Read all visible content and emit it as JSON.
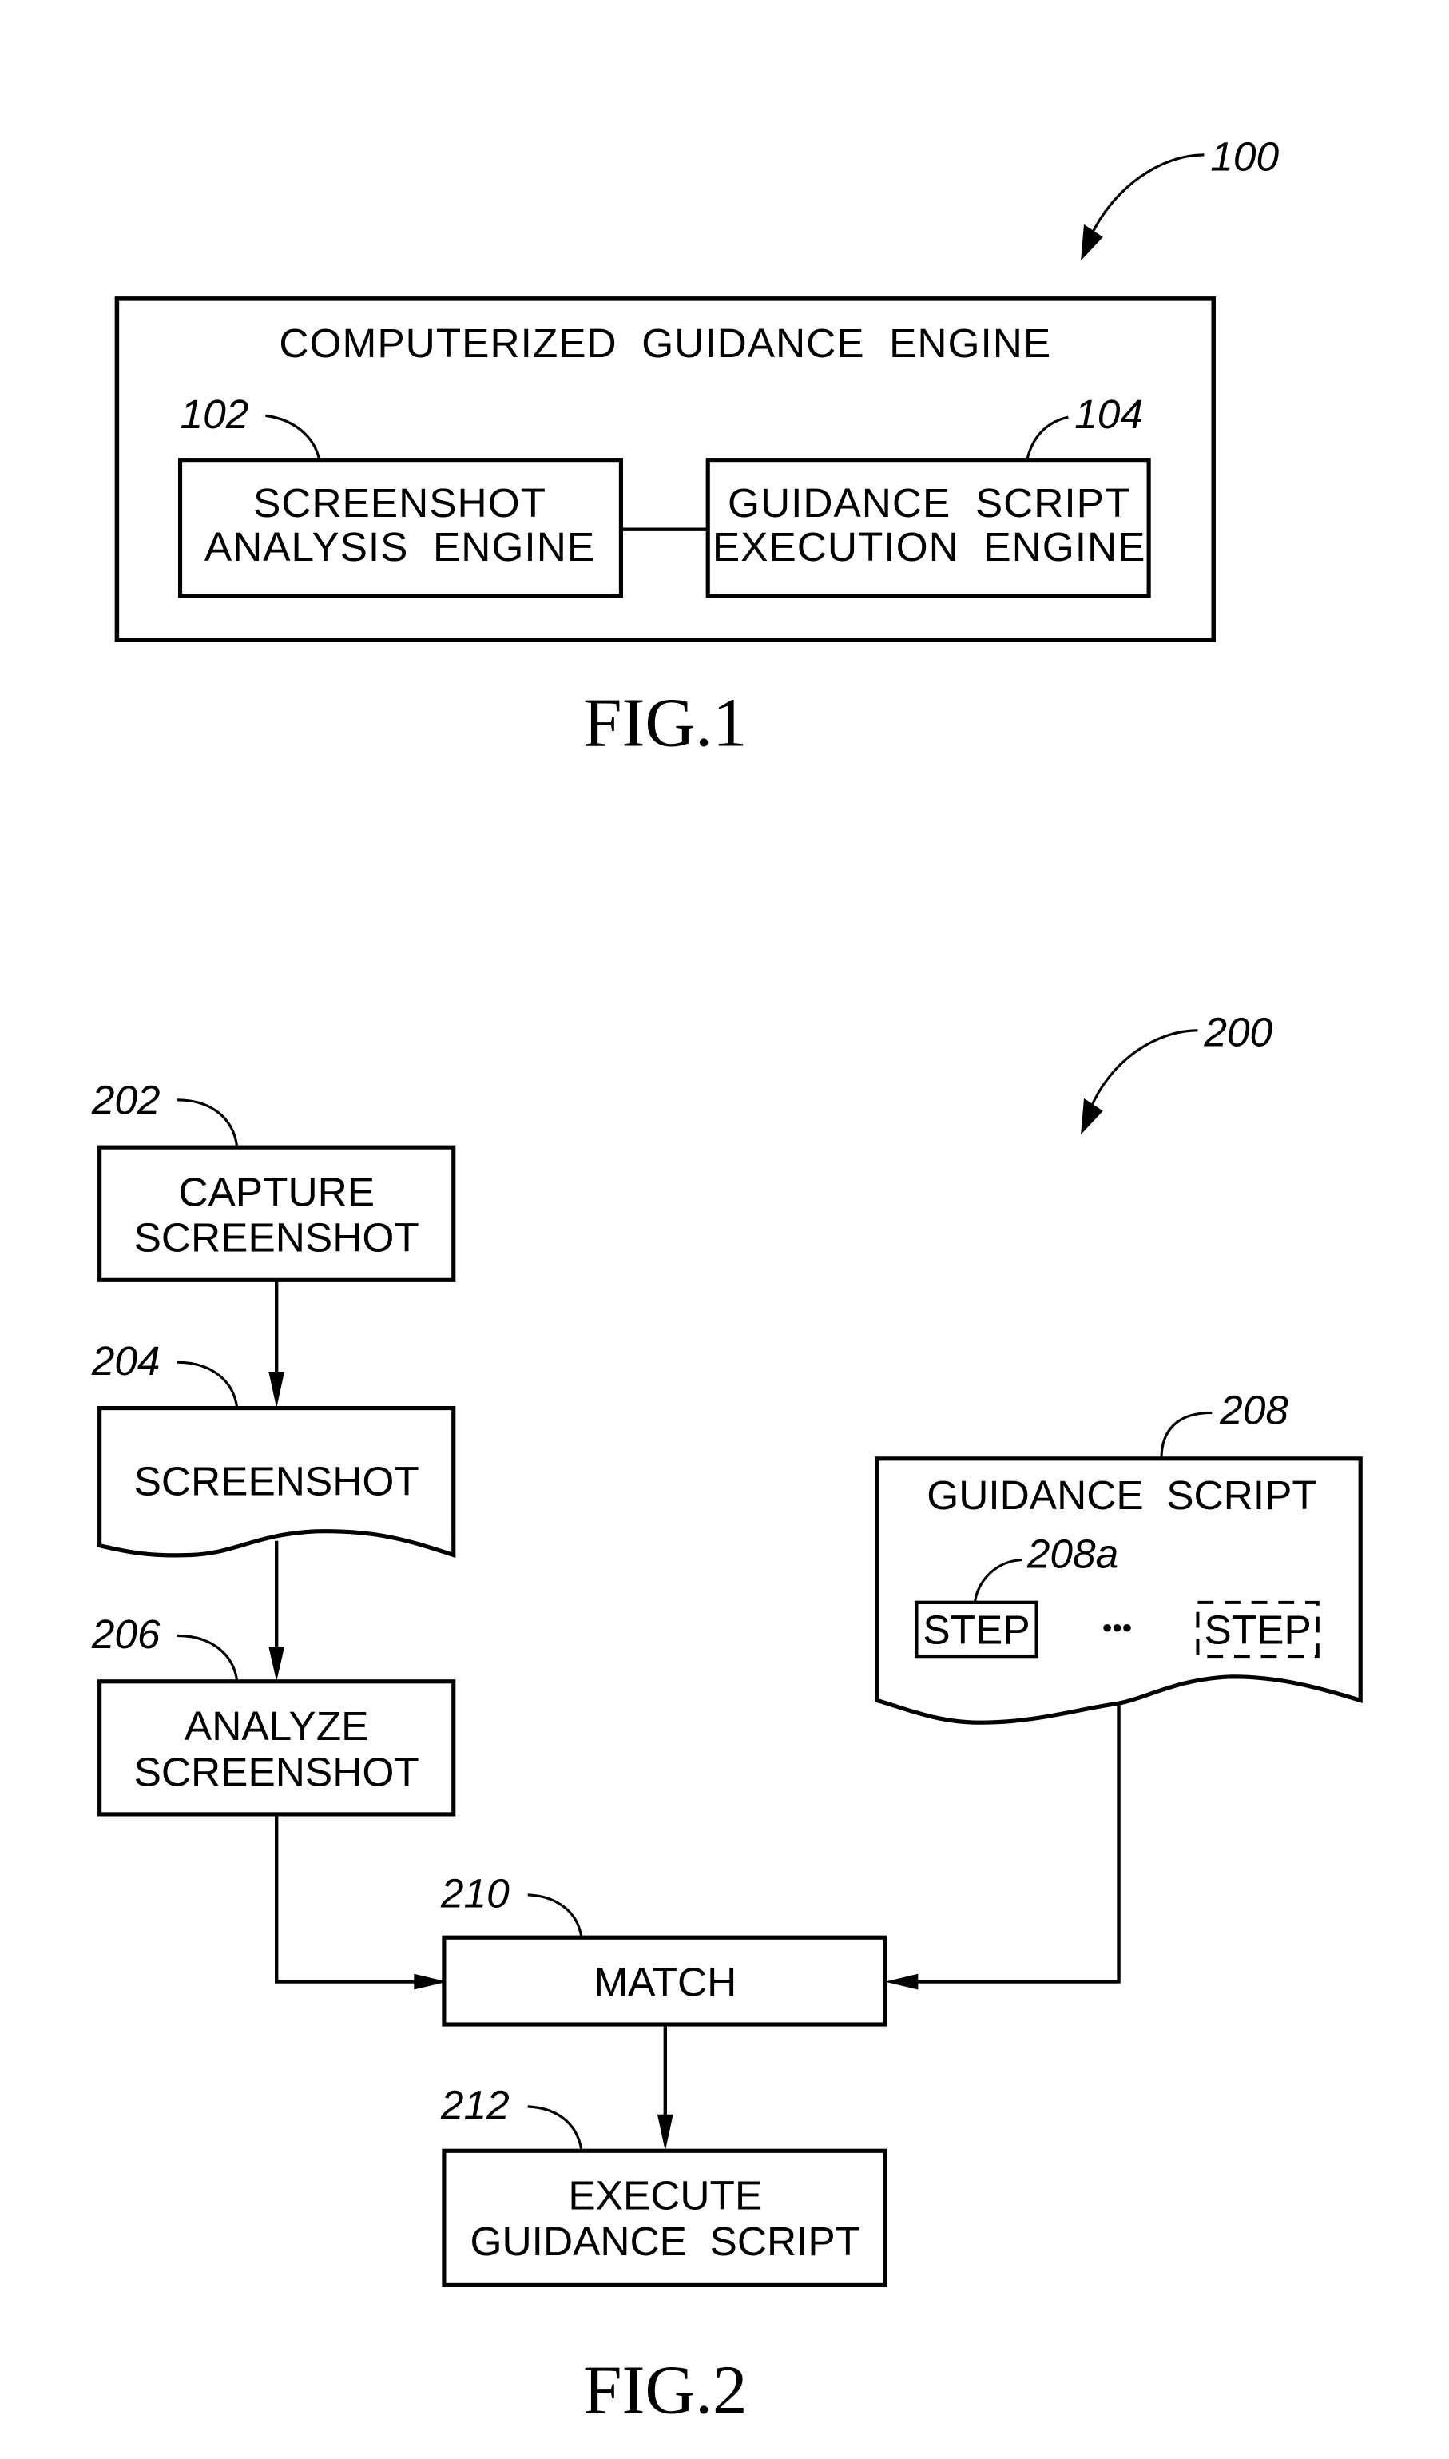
{
  "fig1": {
    "ref": "100",
    "outer_title": "COMPUTERIZED  GUIDANCE  ENGINE",
    "left_box": {
      "ref": "102",
      "line1": "SCREENSHOT",
      "line2": "ANALYSIS  ENGINE"
    },
    "right_box": {
      "ref": "104",
      "line1": "GUIDANCE  SCRIPT",
      "line2": "EXECUTION  ENGINE"
    },
    "caption": "FIG.1"
  },
  "fig2": {
    "ref": "200",
    "capture": {
      "ref": "202",
      "line1": "CAPTURE",
      "line2": "SCREENSHOT"
    },
    "screenshot": {
      "ref": "204",
      "line1": "SCREENSHOT"
    },
    "analyze": {
      "ref": "206",
      "line1": "ANALYZE",
      "line2": "SCREENSHOT"
    },
    "guidance_script": {
      "ref": "208",
      "title": "GUIDANCE  SCRIPT",
      "step_ref": "208a",
      "step_first": "STEP",
      "ellipsis": "•••",
      "step_last": "STEP"
    },
    "match": {
      "ref": "210",
      "line1": "MATCH"
    },
    "execute": {
      "ref": "212",
      "line1": "EXECUTE",
      "line2": "GUIDANCE  SCRIPT"
    },
    "caption": "FIG.2"
  }
}
